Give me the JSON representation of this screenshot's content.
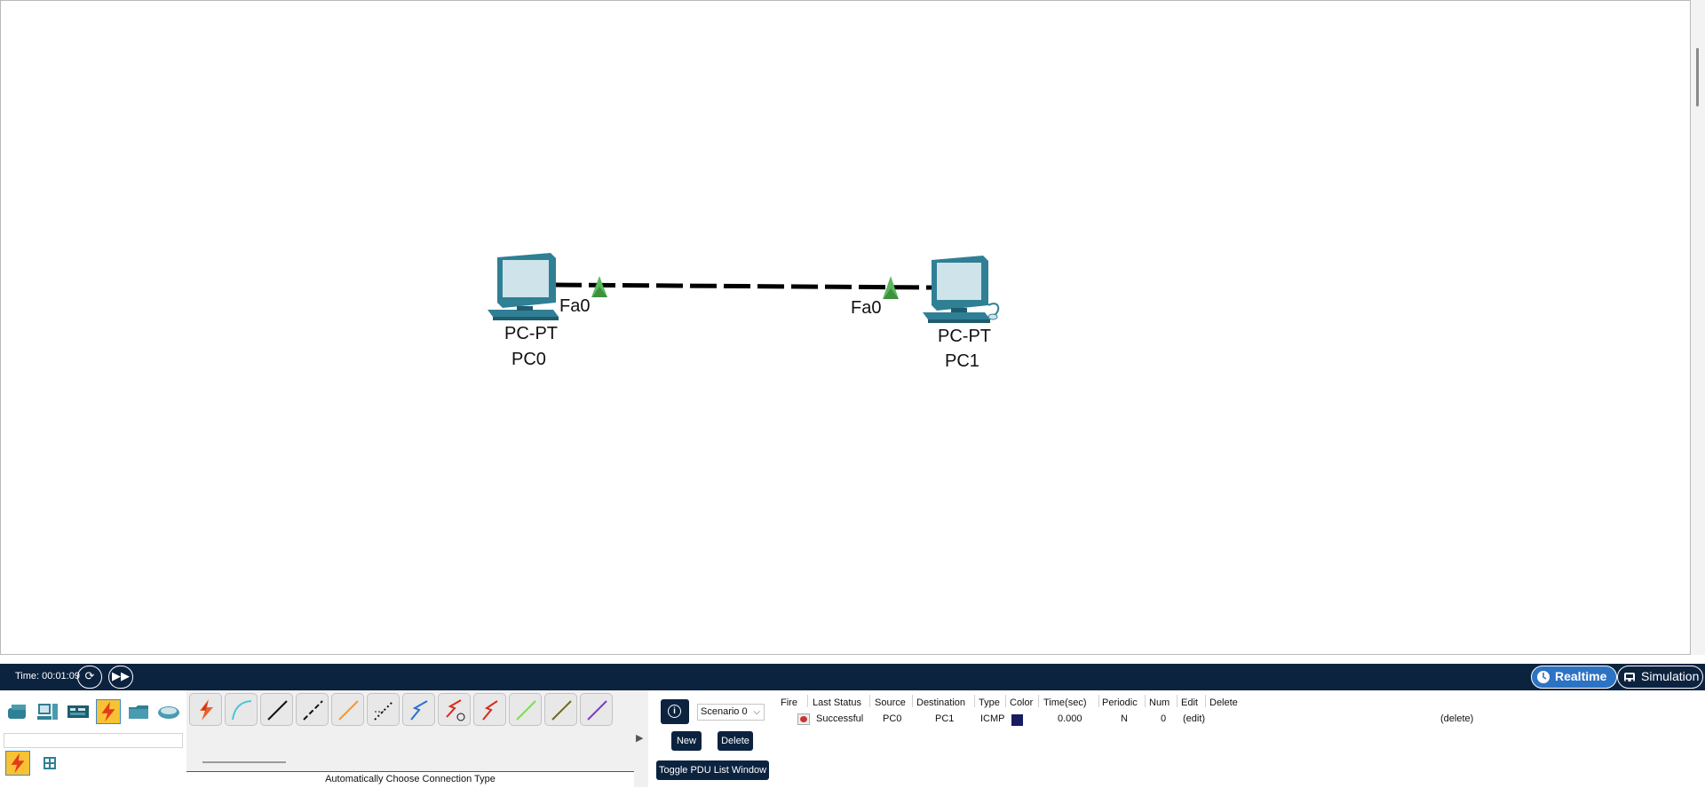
{
  "workspace": {
    "devices": [
      {
        "model": "PC-PT",
        "name": "PC0",
        "port": "Fa0"
      },
      {
        "model": "PC-PT",
        "name": "PC1",
        "port": "Fa0"
      }
    ]
  },
  "statusbar": {
    "time": "Time: 00:01:09",
    "realtime_label": "Realtime",
    "simulation_label": "Simulation"
  },
  "device_panel": {
    "categories": [
      "network-devices",
      "end-devices",
      "components",
      "connections",
      "miscellaneous",
      "multiuser"
    ],
    "active_category": "connections",
    "search_value": ""
  },
  "cable_panel": {
    "cables": [
      "automatic",
      "console",
      "copper-straight-through",
      "copper-cross-over",
      "fiber",
      "phone",
      "coaxial",
      "serial-dce",
      "serial-dte",
      "octal",
      "iot-custom",
      "usb"
    ],
    "description": "Automatically Choose Connection Type"
  },
  "scenario_panel": {
    "scenario": "Scenario 0",
    "new_label": "New",
    "delete_label": "Delete",
    "toggle_label": "Toggle PDU List Window"
  },
  "pdu_list": {
    "headers": [
      "Fire",
      "Last Status",
      "Source",
      "Destination",
      "Type",
      "Color",
      "Time(sec)",
      "Periodic",
      "Num",
      "Edit",
      "Delete"
    ],
    "rows": [
      {
        "last_status": "Successful",
        "source": "PC0",
        "destination": "PC1",
        "type": "ICMP",
        "color": "#1a1a60",
        "time": "0.000",
        "periodic": "N",
        "num": "0",
        "edit": "(edit)",
        "delete": "(delete)"
      }
    ]
  },
  "colors": {
    "statusbar_bg": "#0c2340",
    "realtime_active": "#2c73c4",
    "link_up": "#5cb85c",
    "pc_body": "#2f7f95"
  }
}
